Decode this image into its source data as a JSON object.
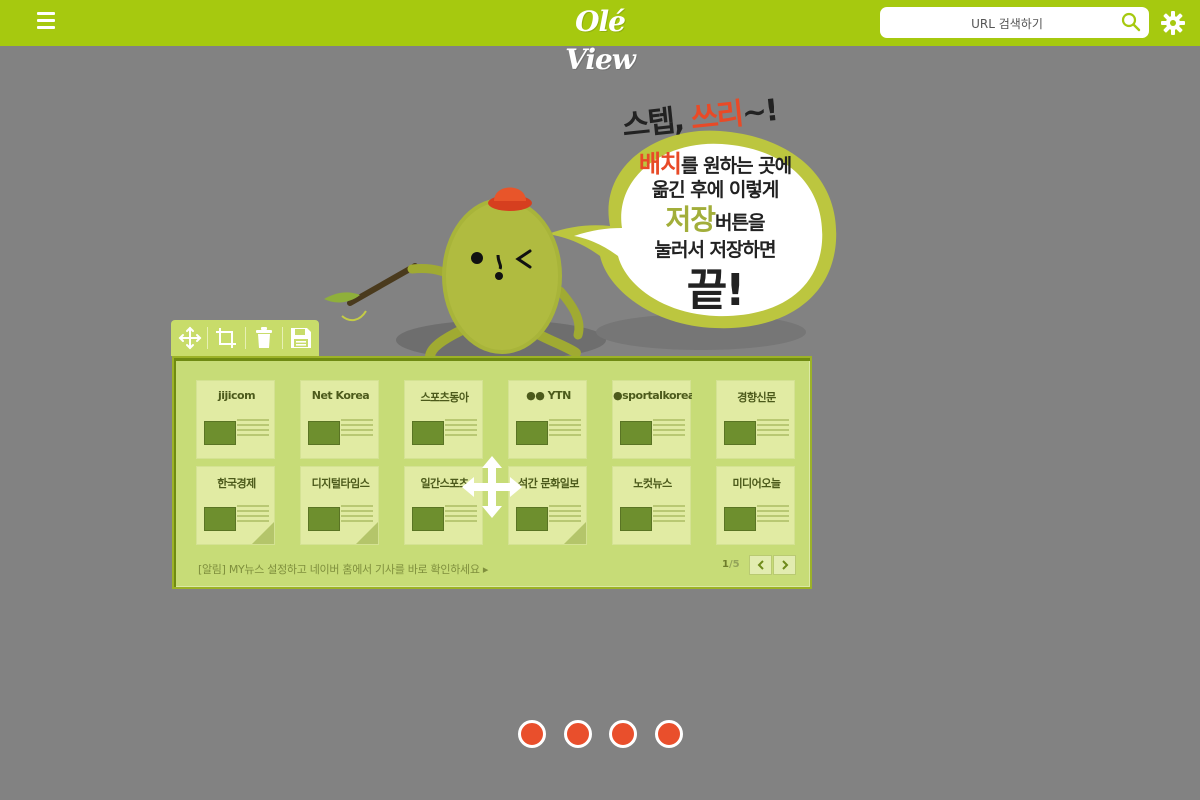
{
  "header": {
    "logo_text": "Olé View",
    "search_placeholder": "URL 검색하기",
    "brand_color": "#a6c90f",
    "icons": [
      "menu-icon",
      "search-icon",
      "gear-icon"
    ]
  },
  "bubble": {
    "title_a": "스텝, ",
    "title_b": "쓰리",
    "title_c": "~!",
    "line1_red": "배치",
    "line1_rest": "를 원하는 곳에",
    "line2": "옮긴 후에 이렇게",
    "line3_olive": "저장",
    "line3_rest": "버튼을",
    "line4": "눌러서 저장하면",
    "final": "끝!"
  },
  "toolbar": {
    "tools": [
      {
        "name": "move-icon"
      },
      {
        "name": "crop-icon"
      },
      {
        "name": "trash-icon"
      },
      {
        "name": "save-icon"
      }
    ]
  },
  "panel": {
    "cards": [
      {
        "name": "jijicom"
      },
      {
        "name": "Net Korea"
      },
      {
        "name": "스포츠동아"
      },
      {
        "name": "●● YTN"
      },
      {
        "name": "●sportalkorea"
      },
      {
        "name": "경향신문"
      },
      {
        "name": "한국경제"
      },
      {
        "name": "디지털타임스"
      },
      {
        "name": "일간스포츠"
      },
      {
        "name": "석간 문화일보"
      },
      {
        "name": "노컷뉴스"
      },
      {
        "name": "미디어오늘"
      }
    ],
    "notice": "[알림] MY뉴스 설정하고 네이버 홈에서 기사를 바로 확인하세요 ▸",
    "page_current": "1",
    "page_total": "/5",
    "colors": {
      "accent_red": "#e94f2c",
      "panel_bg": "#c7dc77"
    }
  },
  "pager": {
    "dots": 4,
    "active_color": "#e94f2c"
  }
}
